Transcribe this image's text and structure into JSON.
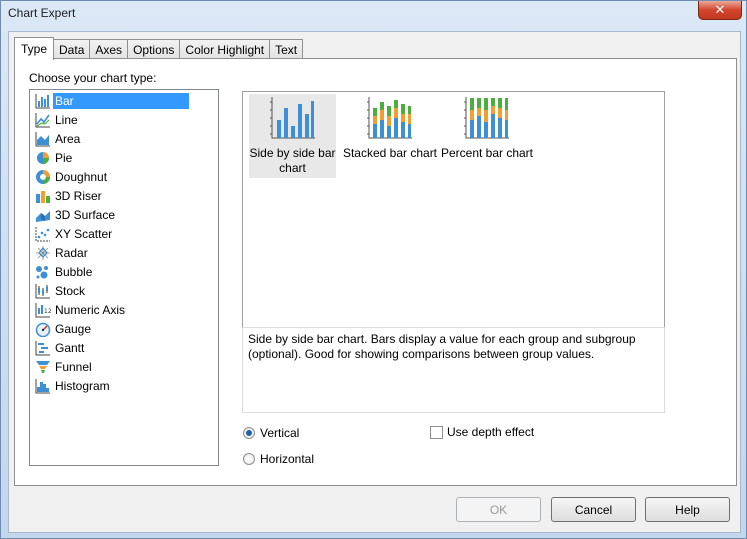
{
  "window": {
    "title": "Chart Expert",
    "close_glyph": "✕"
  },
  "tabs": [
    {
      "label": "Type",
      "active": true
    },
    {
      "label": "Data",
      "active": false
    },
    {
      "label": "Axes",
      "active": false
    },
    {
      "label": "Options",
      "active": false
    },
    {
      "label": "Color Highlight",
      "active": false
    },
    {
      "label": "Text",
      "active": false
    }
  ],
  "chart_type": {
    "label": "Choose your chart type:",
    "items": [
      {
        "label": "Bar",
        "icon": "bar-chart-icon",
        "selected": true
      },
      {
        "label": "Line",
        "icon": "line-chart-icon"
      },
      {
        "label": "Area",
        "icon": "area-chart-icon"
      },
      {
        "label": "Pie",
        "icon": "pie-chart-icon"
      },
      {
        "label": "Doughnut",
        "icon": "doughnut-chart-icon"
      },
      {
        "label": "3D Riser",
        "icon": "3d-riser-icon"
      },
      {
        "label": "3D Surface",
        "icon": "3d-surface-icon"
      },
      {
        "label": "XY Scatter",
        "icon": "xy-scatter-icon"
      },
      {
        "label": "Radar",
        "icon": "radar-chart-icon"
      },
      {
        "label": "Bubble",
        "icon": "bubble-chart-icon"
      },
      {
        "label": "Stock",
        "icon": "stock-chart-icon"
      },
      {
        "label": "Numeric Axis",
        "icon": "numeric-axis-icon"
      },
      {
        "label": "Gauge",
        "icon": "gauge-chart-icon"
      },
      {
        "label": "Gantt",
        "icon": "gantt-chart-icon"
      },
      {
        "label": "Funnel",
        "icon": "funnel-chart-icon"
      },
      {
        "label": "Histogram",
        "icon": "histogram-chart-icon"
      }
    ]
  },
  "subtypes": [
    {
      "label_line1": "Side by side bar",
      "label_line2": "chart",
      "selected": true
    },
    {
      "label_line1": "Stacked bar chart",
      "label_line2": ""
    },
    {
      "label_line1": "Percent bar chart",
      "label_line2": ""
    }
  ],
  "description": "Side by side bar chart. Bars display a value for each group and subgroup (optional). Good for showing comparisons between group values.",
  "orientation": {
    "vertical_label": "Vertical",
    "horizontal_label": "Horizontal",
    "selected": "Vertical"
  },
  "depth_effect": {
    "label": "Use depth effect",
    "checked": false
  },
  "buttons": {
    "ok": "OK",
    "cancel": "Cancel",
    "help": "Help"
  },
  "colors": {
    "accent": "#3399ff",
    "bar_blue": "#3d8fd6",
    "bar_orange": "#f0a030",
    "bar_green": "#4cae3c"
  }
}
